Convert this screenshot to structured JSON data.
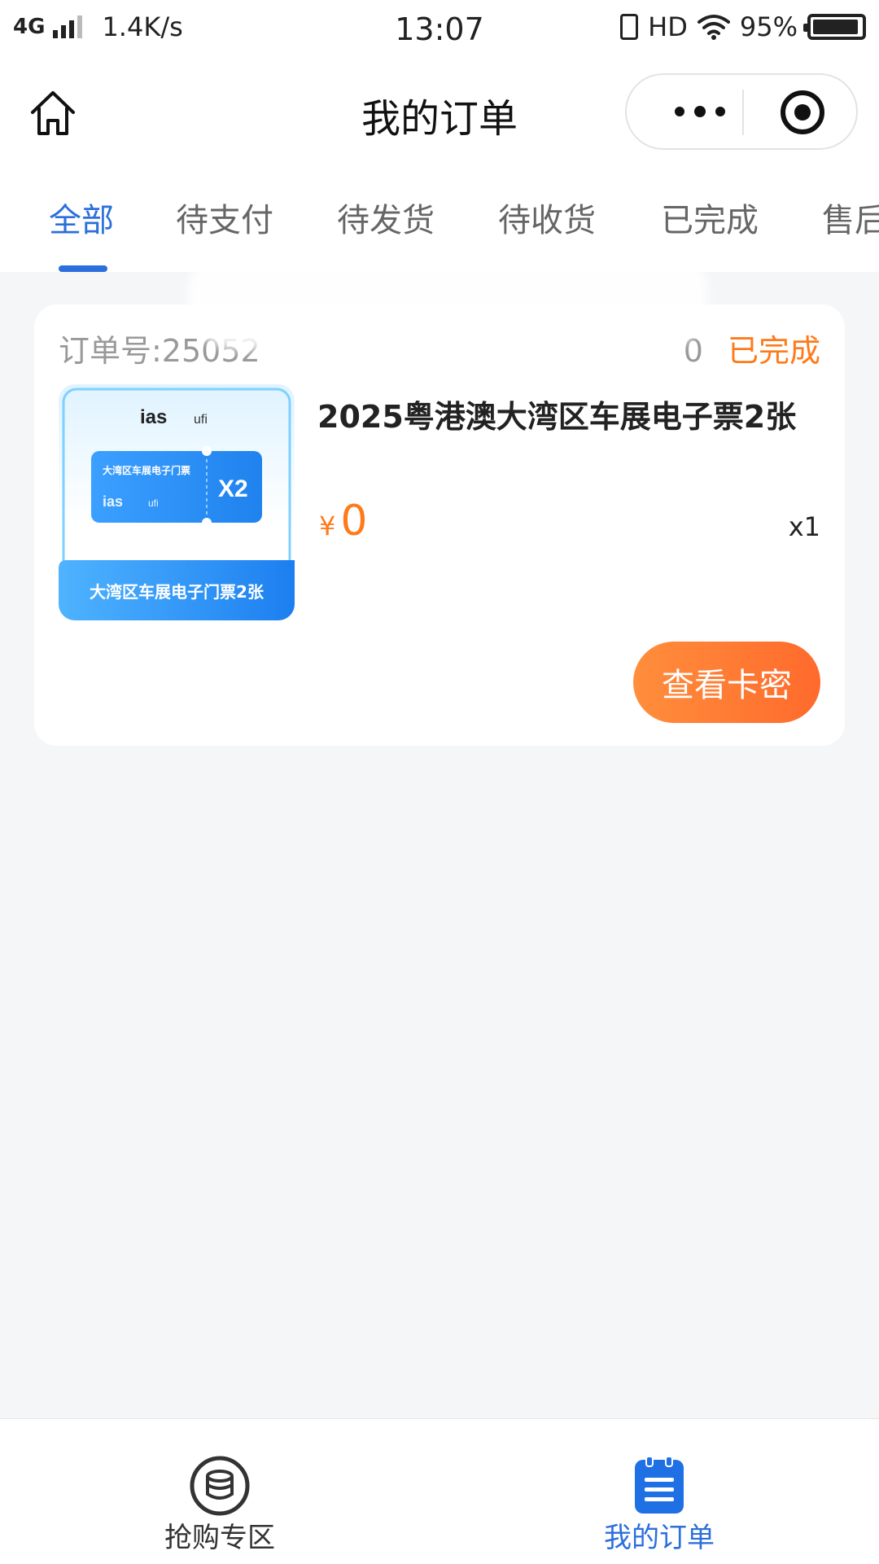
{
  "status_bar": {
    "network": "4G",
    "speed": "1.4K/s",
    "time": "13:07",
    "hd": "HD",
    "battery": "95%",
    "battery_level": 0.95
  },
  "nav": {
    "title": "我的订单"
  },
  "tabs": [
    {
      "label": "全部",
      "active": true
    },
    {
      "label": "待支付"
    },
    {
      "label": "待发货"
    },
    {
      "label": "待收货"
    },
    {
      "label": "已完成"
    },
    {
      "label": "售后"
    }
  ],
  "order": {
    "order_no": "订单号:25052",
    "order_no_tail": "0",
    "status": "已完成",
    "product_title": "2025粤港澳大湾区车展电子票2张",
    "currency": "¥",
    "price": "0",
    "quantity": "x1",
    "action_label": "查看卡密",
    "thumbnail": {
      "brand": "ias",
      "partner": "ufi",
      "ticket_title": "大湾区车展电子门票",
      "ticket_count": "X2",
      "banner": "大湾区车展电子门票2张",
      "accent": "#1e8fff"
    }
  },
  "tabbar": [
    {
      "label": "抢购专区",
      "icon": "coins-stack-icon",
      "active": false
    },
    {
      "label": "我的订单",
      "icon": "order-list-icon",
      "active": true
    }
  ],
  "colors": {
    "primary": "#2b6fdc",
    "accent": "#ff7a1a",
    "background": "#f5f6f8"
  }
}
